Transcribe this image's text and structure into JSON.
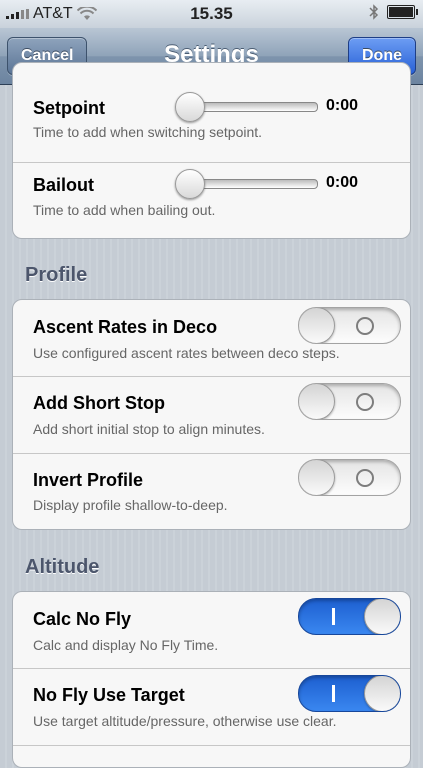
{
  "status_bar": {
    "carrier": "AT&T",
    "time": "15.35"
  },
  "nav": {
    "title": "Settings",
    "cancel": "Cancel",
    "done": "Done"
  },
  "setpoint_group": [
    {
      "label": "Setpoint",
      "desc": "Time to add when switching setpoint.",
      "value": "0:00"
    },
    {
      "label": "Bailout",
      "desc": "Time to add when bailing out.",
      "value": "0:00"
    }
  ],
  "profile": {
    "header": "Profile",
    "rows": [
      {
        "label": "Ascent Rates in Deco",
        "desc": "Use configured ascent rates between deco steps.",
        "on": false
      },
      {
        "label": "Add Short Stop",
        "desc": "Add short initial stop to align minutes.",
        "on": false
      },
      {
        "label": "Invert Profile",
        "desc": "Display profile shallow-to-deep.",
        "on": false
      }
    ]
  },
  "altitude": {
    "header": "Altitude",
    "rows": [
      {
        "label": "Calc No Fly",
        "desc": "Calc and display No Fly Time.",
        "on": true
      },
      {
        "label": "No Fly Use Target",
        "desc": "Use target altitude/pressure, otherwise use clear.",
        "on": true
      }
    ]
  }
}
